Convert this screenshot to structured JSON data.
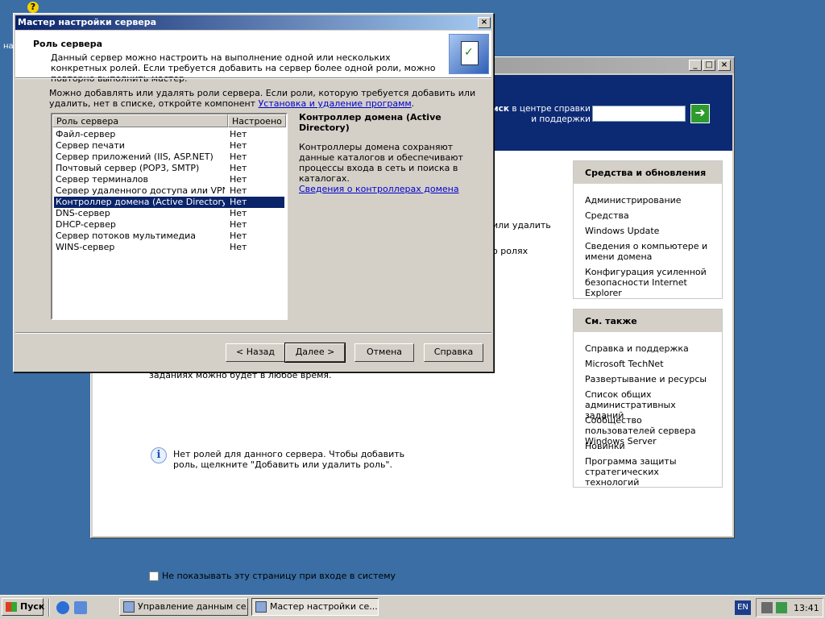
{
  "desktop": {
    "badge": "?",
    "left_label": "на"
  },
  "background_window": {
    "help_search_text_bold": "иск",
    "help_search_text": " в центре справки и поддержки",
    "go_icon": "arrow-right-icon",
    "partial_line_1": "или удалить",
    "partial_line_2": "о ролях",
    "partial_bottom_text": "заданиях можно будет в любое время.",
    "info_text": "Нет ролей для данного сервера. Чтобы добавить роль, щелкните \"Добавить или удалить роль\".",
    "checkbox_label": "Не показывать эту страницу при входе в систему",
    "tools_panel": {
      "title": "Средства и обновления",
      "items": [
        "Администрирование",
        "Средства",
        "Windows Update",
        "Сведения о компьютере и имени домена",
        "Конфигурация усиленной безопасности Internet Explorer"
      ]
    },
    "see_also_panel": {
      "title": "См. также",
      "items": [
        "Справка и поддержка",
        "Microsoft TechNet",
        "Развертывание и ресурсы",
        "Список общих административных заданий",
        "Сообщество пользователей сервера Windows Server",
        "Новинки",
        "Программа защиты стратегических технологий"
      ]
    }
  },
  "wizard": {
    "title": "Мастер настройки сервера",
    "close_label": "×",
    "header_title": "Роль сервера",
    "header_desc": "Данный сервер можно настроить на выполнение одной или нескольких конкретных ролей. Если требуется добавить на сервер более одной роли, можно повторно выполнить мастер.",
    "body_text": "Можно добавлять или удалять роли сервера. Если роли, которую требуется добавить или удалить, нет в списке, откройте компонент ",
    "body_link": "Установка и удаление программ",
    "body_text_end": ".",
    "columns": [
      "Роль сервера",
      "Настроено"
    ],
    "roles": [
      {
        "name": "Файл-сервер",
        "configured": "Нет"
      },
      {
        "name": "Сервер печати",
        "configured": "Нет"
      },
      {
        "name": "Сервер приложений (IIS, ASP.NET)",
        "configured": "Нет"
      },
      {
        "name": "Почтовый сервер (POP3, SMTP)",
        "configured": "Нет"
      },
      {
        "name": "Сервер терминалов",
        "configured": "Нет"
      },
      {
        "name": "Сервер удаленного доступа или VPN-с...",
        "configured": "Нет"
      },
      {
        "name": "Контроллер домена (Active Directory)",
        "configured": "Нет"
      },
      {
        "name": "DNS-сервер",
        "configured": "Нет"
      },
      {
        "name": "DHCP-сервер",
        "configured": "Нет"
      },
      {
        "name": "Сервер потоков мультимедиа",
        "configured": "Нет"
      },
      {
        "name": "WINS-сервер",
        "configured": "Нет"
      }
    ],
    "selected_index": 6,
    "desc_title": "Контроллер домена (Active Directory)",
    "desc_text": "Контроллеры домена сохраняют данные каталогов и обеспечивают процессы входа в сеть и поиска в каталогах.",
    "desc_link": "Сведения о контроллерах домена",
    "buttons": {
      "back": "< Назад",
      "next": "Далее >",
      "cancel": "Отмена",
      "help": "Справка"
    }
  },
  "taskbar": {
    "start": "Пуск",
    "tasks": [
      "Управление данным се...",
      "Мастер настройки се..."
    ],
    "lang": "EN",
    "clock": "13:41"
  }
}
